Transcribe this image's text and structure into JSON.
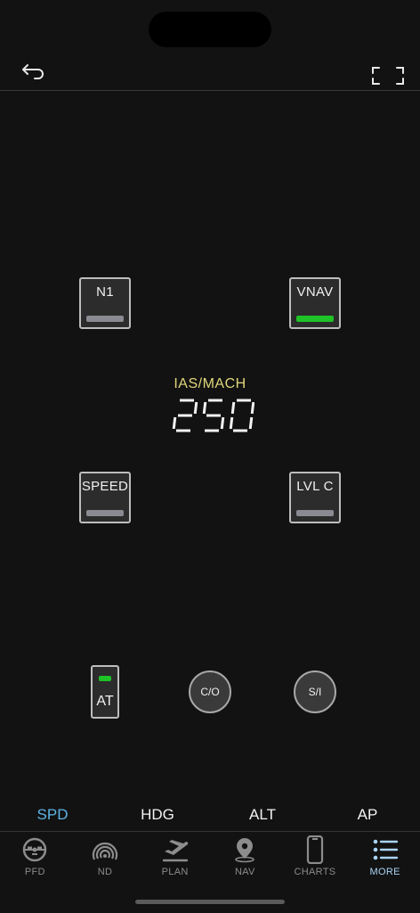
{
  "header": {
    "back_icon": "back-arrow-icon",
    "fullscreen_icon": "fullscreen-icon"
  },
  "mcp": {
    "buttons": {
      "n1": {
        "label": "N1",
        "active": false
      },
      "vnav": {
        "label": "VNAV",
        "active": true
      },
      "speed": {
        "label": "SPEED",
        "active": false
      },
      "lvlc": {
        "label": "LVL C",
        "active": false
      }
    },
    "ias_label": "IAS/MACH",
    "ias_value": "250",
    "at": {
      "label": "AT",
      "armed": true
    },
    "co_label": "C/O",
    "si_label": "S/I"
  },
  "mode_tabs": [
    {
      "label": "SPD",
      "active": true
    },
    {
      "label": "HDG",
      "active": false
    },
    {
      "label": "ALT",
      "active": false
    },
    {
      "label": "AP",
      "active": false
    }
  ],
  "tabbar": [
    {
      "label": "PFD",
      "icon": "attitude-indicator-icon",
      "active": false
    },
    {
      "label": "ND",
      "icon": "radar-icon",
      "active": false
    },
    {
      "label": "PLAN",
      "icon": "airplane-departure-icon",
      "active": false
    },
    {
      "label": "NAV",
      "icon": "map-pin-icon",
      "active": false
    },
    {
      "label": "CHARTS",
      "icon": "tablet-icon",
      "active": false
    },
    {
      "label": "MORE",
      "icon": "list-icon",
      "active": true
    }
  ],
  "colors": {
    "background": "#121212",
    "active_green": "#1fc227",
    "ias_label": "#e0d77a",
    "mode_active": "#5cb4e6",
    "tab_active": "#a9d4f5"
  }
}
